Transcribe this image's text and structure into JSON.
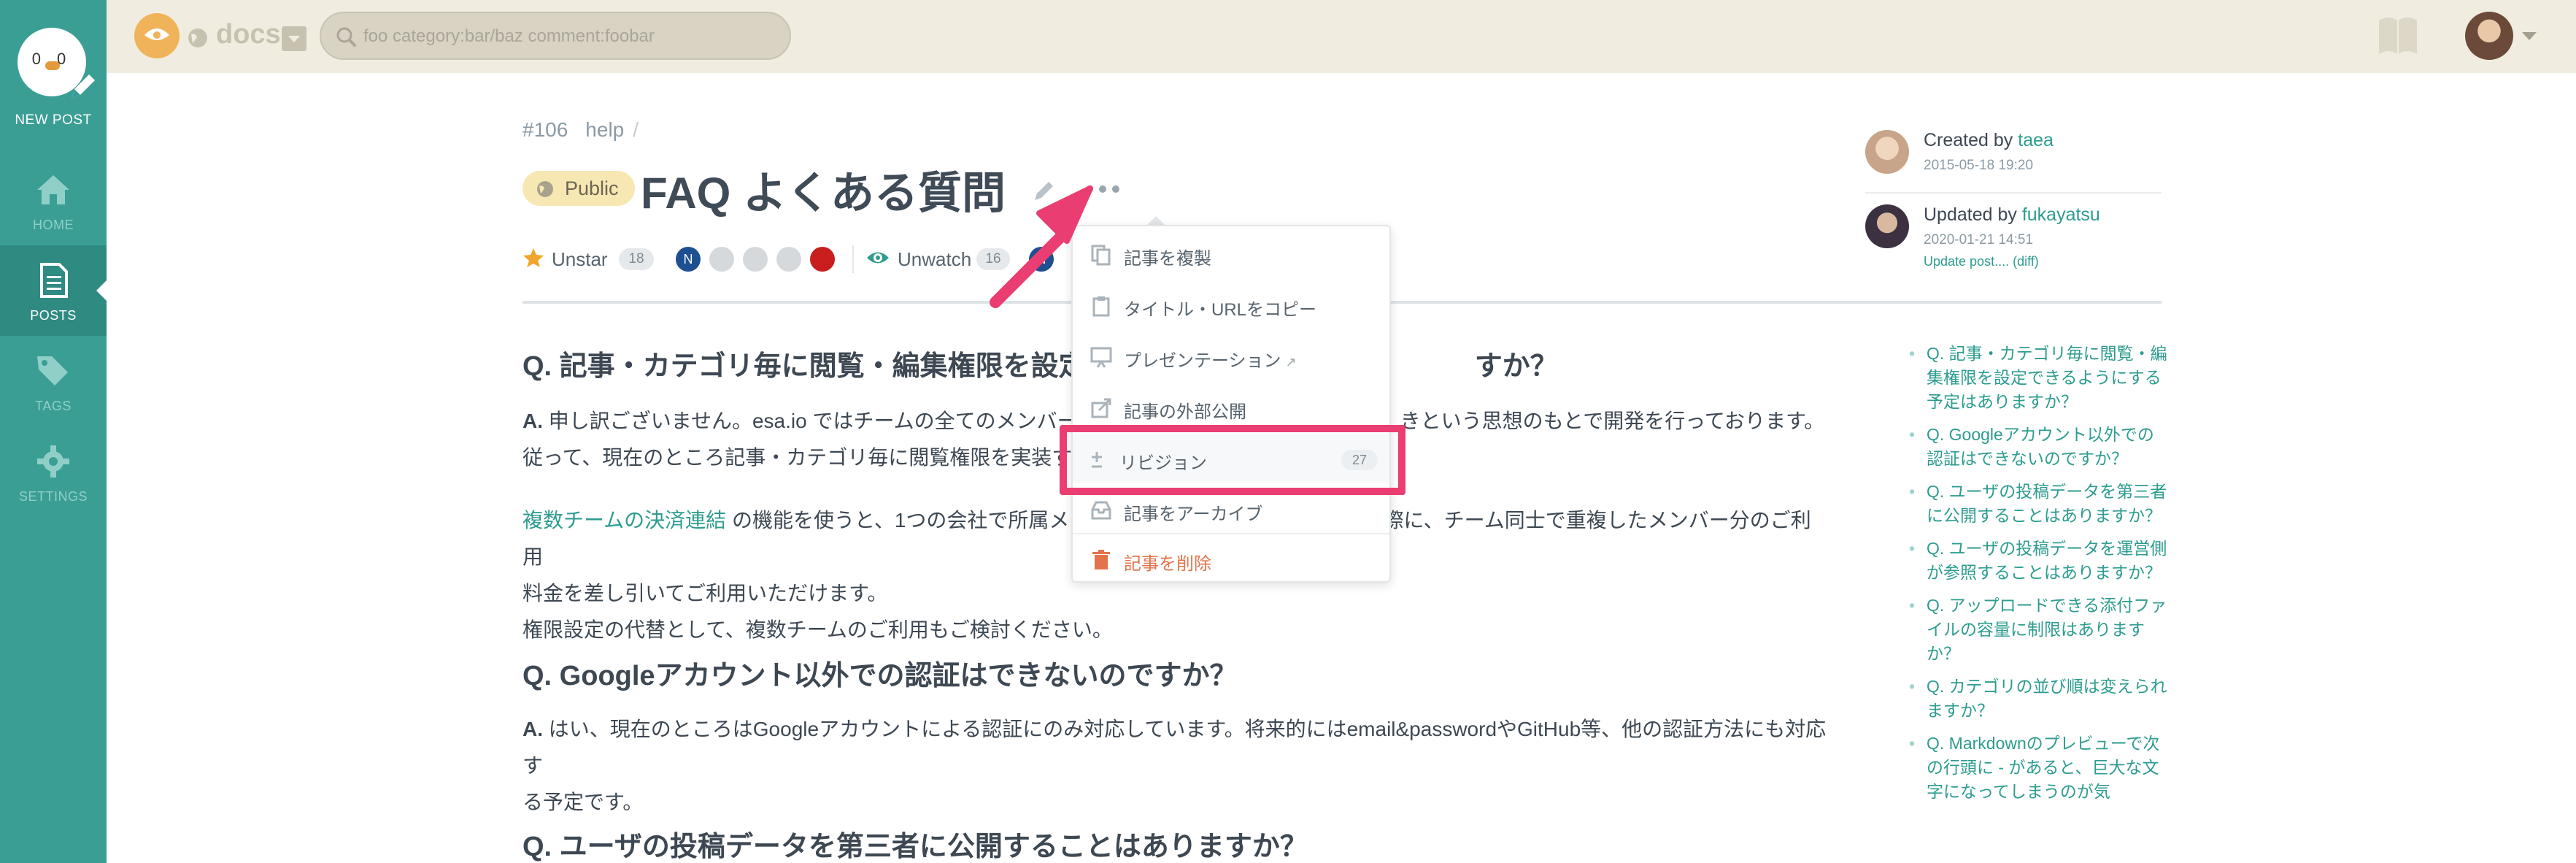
{
  "sidebar": {
    "new_post_label": "NEW POST",
    "new_post_face": "0 0",
    "items": [
      {
        "label": "HOME",
        "icon": "home-icon"
      },
      {
        "label": "POSTS",
        "icon": "posts-icon"
      },
      {
        "label": "TAGS",
        "icon": "tags-icon"
      },
      {
        "label": "SETTINGS",
        "icon": "settings-icon"
      }
    ]
  },
  "topbar": {
    "team_name": "docs",
    "search_placeholder": "foo category:bar/baz comment:foobar"
  },
  "post": {
    "number": "#106",
    "category": "help",
    "category_sep": "/",
    "visibility": "Public",
    "title": "FAQ よくある質問",
    "star_label": "Unstar",
    "star_count": "18",
    "watch_label": "Unwatch",
    "watch_count": "16",
    "avatar_initial": "N"
  },
  "author": {
    "created_prefix": "Created by",
    "created_user": "taea",
    "created_at": "2015-05-18 19:20",
    "updated_prefix": "Updated by",
    "updated_user": "fukayatsu",
    "updated_at": "2020-01-21 14:51",
    "update_note": "Update post.... (diff)"
  },
  "content": {
    "q1_title": "Q. 記事・カテゴリ毎に閲覧・編集権限を設定でき",
    "q1_title_tail": "すか？",
    "q1_a_prefix": "A.",
    "q1_a_line1": "申し訳ございません。esa.io ではチームの全てのメンバー",
    "q1_a_line1_tail": "きという思想のもとで開発を行っております。",
    "q1_a_line2": "従って、現在のところ記事・カテゴリ毎に閲覧権限を実装す",
    "q1_link": "複数チームの決済連結",
    "q1_p2_a": "の機能を使うと、1つの会社で所属メ",
    "q1_p2_tail": "際に、チーム同士で重複したメンバー分のご利用",
    "q1_p2_line2": "料金を差し引いてご利用いただけます。",
    "q1_p2_line3": "権限設定の代替として、複数チームのご利用もご検討ください。",
    "q2_title": "Q. Googleアカウント以外での認証はできないのですか？",
    "q2_a_prefix": "A.",
    "q2_a_line1": "はい、現在のところはGoogleアカウントによる認証にのみ対応しています。将来的にはemail&passwordやGitHub等、他の認証方法にも対応す",
    "q2_a_line2": "る予定です。",
    "q3_title": "Q. ユーザの投稿データを第三者に公開することはありますか？"
  },
  "toc": [
    "Q. 記事・カテゴリ毎に閲覧・編集権限を設定できるようにする予定はありますか？",
    "Q. Googleアカウント以外での認証はできないのですか？",
    "Q. ユーザの投稿データを第三者に公開することはありますか？",
    "Q. ユーザの投稿データを運営側が参照することはありますか？",
    "Q. アップロードできる添付ファイルの容量に制限はありますか？",
    "Q. カテゴリの並び順は変えられますか？",
    "Q. Markdownのプレビューで次の行頭に - があると、巨大な文字になってしまうのが気"
  ],
  "dropdown": {
    "duplicate": "記事を複製",
    "copy_title_url": "タイトル・URLをコピー",
    "presentation": "プレゼンテーション",
    "external_share": "記事の外部公開",
    "revision": "リビジョン",
    "revision_count": "27",
    "archive": "記事をアーカイブ",
    "delete": "記事を削除"
  },
  "colors": {
    "sidebar": "#3a9e95",
    "topbar": "#f0ede0",
    "accent": "#2d9c8f",
    "highlight": "#ea3d72",
    "danger": "#e2734a"
  }
}
